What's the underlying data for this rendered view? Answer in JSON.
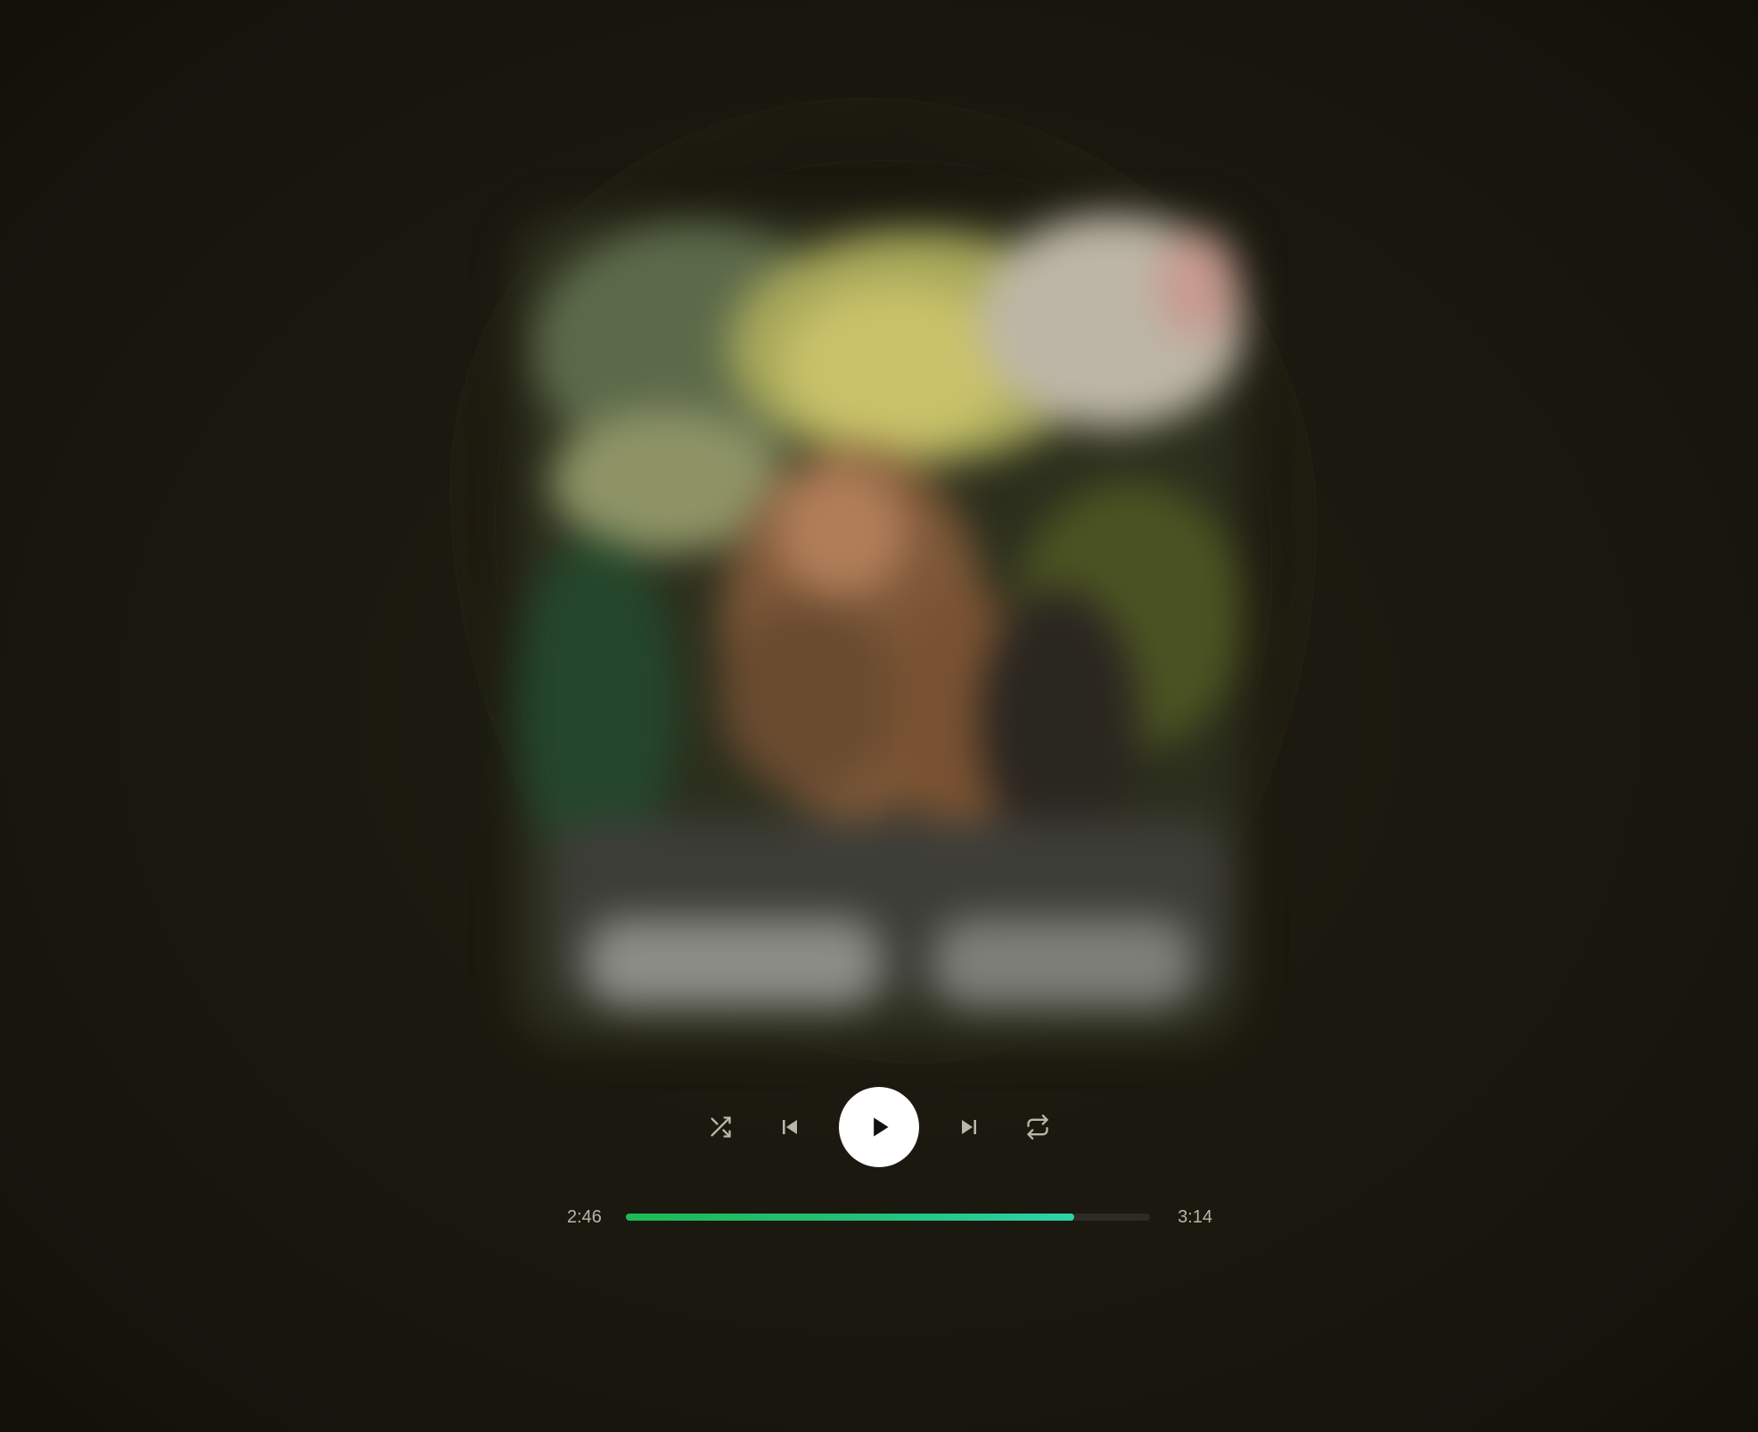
{
  "player": {
    "artwork": {
      "description_icon": "album-artwork",
      "state": "blurred"
    },
    "controls": {
      "shuffle_icon": "shuffle-icon",
      "previous_icon": "skip-previous-icon",
      "play_icon": "play-icon",
      "next_icon": "skip-next-icon",
      "repeat_icon": "repeat-icon"
    },
    "progress": {
      "elapsed": "2:46",
      "total": "3:14",
      "fraction": 0.856
    },
    "colors": {
      "accent_start": "#1db954",
      "accent_end": "#2dd4a8",
      "background": "#1b190f",
      "play_button": "#ffffff"
    }
  }
}
